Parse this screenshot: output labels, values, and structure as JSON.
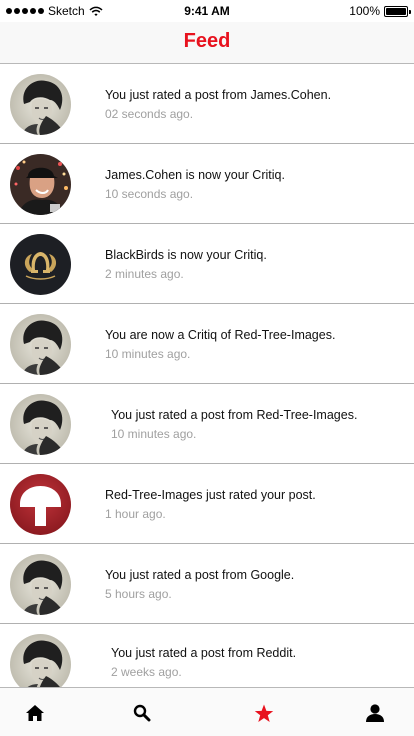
{
  "status_bar": {
    "carrier": "Sketch",
    "time": "9:41 AM",
    "battery": "100%"
  },
  "header": {
    "title": "Feed",
    "accent_color": "#e8121e"
  },
  "feed": {
    "items": [
      {
        "avatar": "portrait-bw",
        "message": "You just rated a post from James.Cohen.",
        "time": "02 seconds ago."
      },
      {
        "avatar": "portrait-cap",
        "message": "James.Cohen is now your Critiq.",
        "time": "10 seconds ago."
      },
      {
        "avatar": "blackbirds-logo",
        "message": "BlackBirds is now your Critiq.",
        "time": "2 minutes ago."
      },
      {
        "avatar": "portrait-bw",
        "message": "You are now a Critiq of Red-Tree-Images.",
        "time": "10 minutes ago."
      },
      {
        "avatar": "portrait-bw",
        "message": "You just rated a post from Red-Tree-Images.",
        "time": "10 minutes ago."
      },
      {
        "avatar": "red-tree-logo",
        "message": "Red-Tree-Images just rated your post.",
        "time": "1 hour ago."
      },
      {
        "avatar": "portrait-bw",
        "message": "You just rated a post from Google.",
        "time": "5 hours ago."
      },
      {
        "avatar": "portrait-bw",
        "message": "You just rated a post from Reddit.",
        "time": "2 weeks ago."
      }
    ]
  },
  "tab_bar": {
    "tabs": [
      {
        "icon": "home-icon",
        "active": false
      },
      {
        "icon": "search-icon",
        "active": false
      },
      {
        "icon": "star-icon",
        "active": true
      },
      {
        "icon": "user-icon",
        "active": false
      }
    ]
  }
}
